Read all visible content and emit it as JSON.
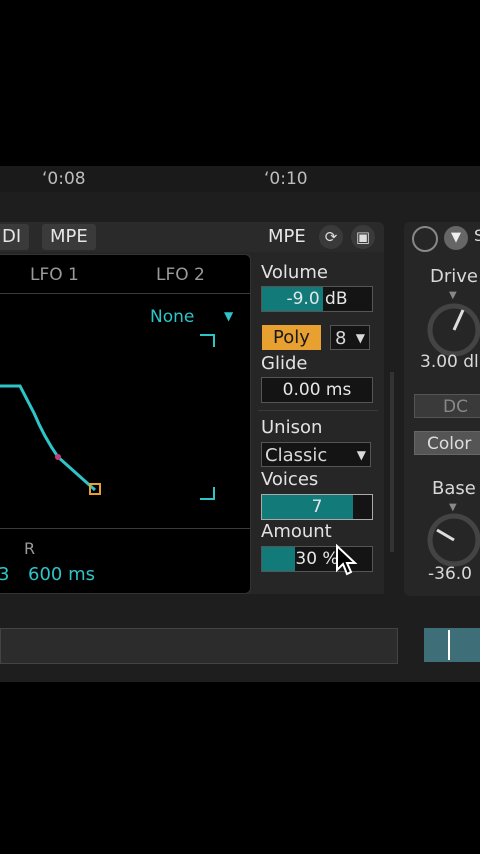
{
  "timeline": {
    "marks": [
      "ʻ0:08",
      "ʻ0:10"
    ]
  },
  "instrument": {
    "header": {
      "midi_label": "DI",
      "mpe_tab": "MPE",
      "mpe_title": "MPE"
    },
    "envelope": {
      "tabs": [
        "LFO 1",
        "LFO 2"
      ],
      "dropdown_value": "None",
      "param_label": "R",
      "left_value": "3",
      "release_value": "600 ms"
    },
    "controls": {
      "volume": {
        "label": "Volume",
        "value": "-9.0 dB",
        "level": 0.55
      },
      "poly": {
        "label": "Poly",
        "voices_count": "8"
      },
      "glide": {
        "label": "Glide",
        "value": "0.00 ms"
      },
      "unison": {
        "label": "Unison",
        "mode": "Classic"
      },
      "voices": {
        "label": "Voices",
        "value": "7",
        "level": 0.83
      },
      "amount": {
        "label": "Amount",
        "value": "30 %",
        "level": 0.3
      }
    }
  },
  "right_device": {
    "drive": {
      "label": "Drive",
      "value": "3.00 dl"
    },
    "dc_button": "DC",
    "color_button": "Color",
    "base": {
      "label": "Base",
      "value": "-36.0"
    }
  },
  "colors": {
    "accent": "#2ec4c8",
    "poly_orange": "#e8a030",
    "fill_teal": "#137a7a"
  }
}
